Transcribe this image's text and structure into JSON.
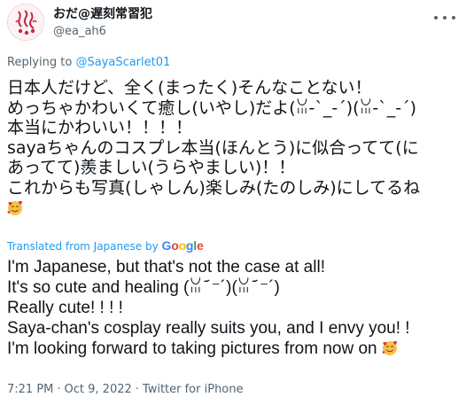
{
  "author": {
    "display_name": "おだ@遅刻常習犯",
    "handle": "@ea_ah6"
  },
  "reply_context": {
    "prefix": "Replying to ",
    "mention": "@SayaScarlet01"
  },
  "tweet_text_original": [
    "日本人だけど、全く(まったく)そんなことない！",
    "めっちゃかわいくて癒し(いやし)だよ(ꈍ-`_-´)(ꈍ-`_-´)",
    "本当にかわいい！！！！",
    "sayaちゃんのコスプレ本当(ほんとう)に似合ってて(に",
    "あってて)羨ましい(うらやましい)！！",
    "これからも写真(しゃしん)楽しみ(たのしみ)にしてるね"
  ],
  "translation_label": {
    "prefix": "Translated from Japanese by ",
    "provider": "Google"
  },
  "tweet_text_translated": [
    "I'm Japanese, but that's not the case at all!",
    "It's so cute and healing (ꈍ ᷄᷄ ⁻´)(ꈍ ᷄᷄ ⁻´)",
    "Really cute! ! ! !",
    "Saya-chan's cosplay really suits you, and I envy you! !",
    "I'm looking forward to taking pictures from now on"
  ],
  "emoji": "smiling-face-with-hearts",
  "meta": {
    "time": "7:21 PM",
    "date": "Oct 9, 2022",
    "separator": "·",
    "source": "Twitter for iPhone"
  },
  "colors": {
    "text": "#0f1419",
    "secondary": "#536471",
    "link": "#1d9bf0",
    "avatar_accent": "#c8284a",
    "emoji": "#f6c343",
    "heart": "#e8283c",
    "google_blue": "#4285F4",
    "google_red": "#EA4335",
    "google_yellow": "#FBBC05",
    "google_green": "#34A853"
  }
}
